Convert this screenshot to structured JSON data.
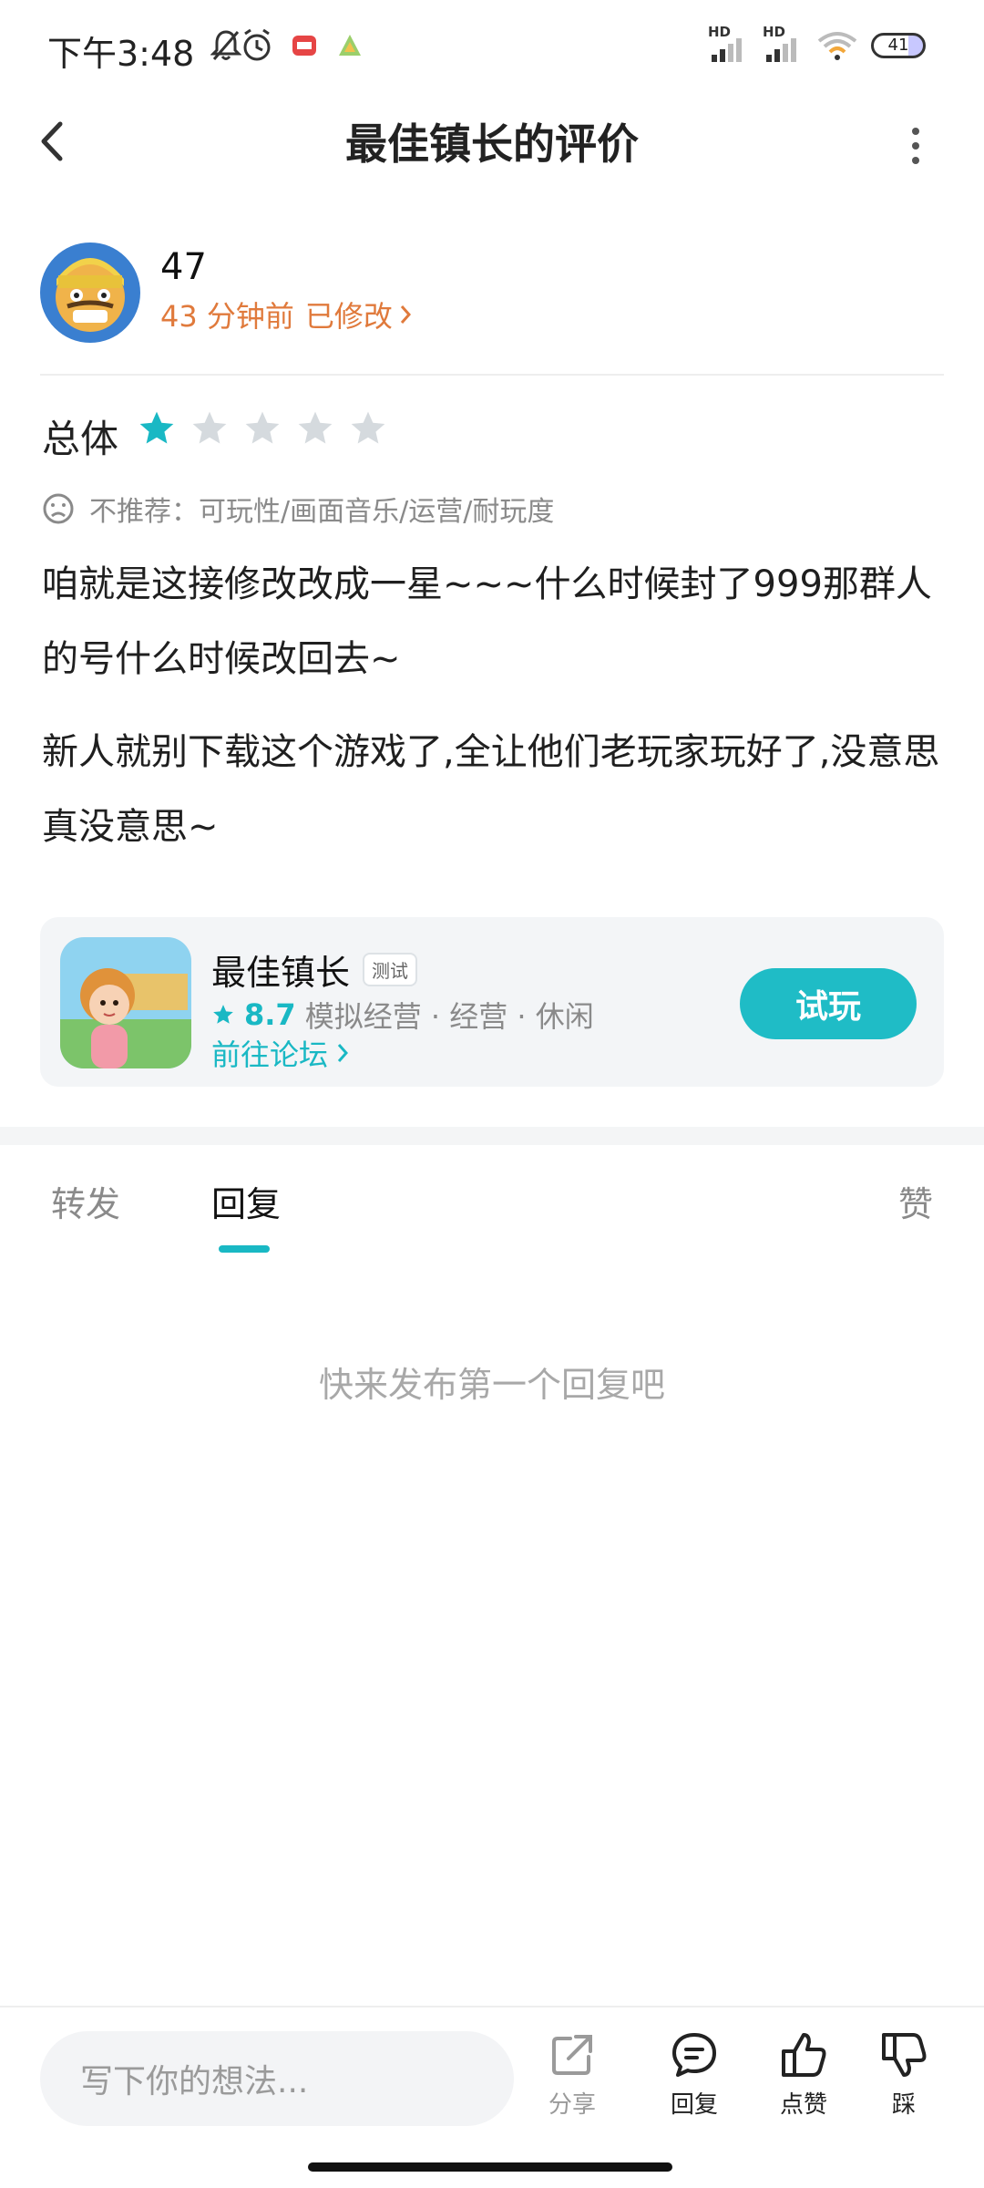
{
  "status_bar": {
    "time": "下午3:48",
    "hd1": "HD",
    "hd2": "HD",
    "battery": "41"
  },
  "header": {
    "title": "最佳镇长的评价"
  },
  "author": {
    "name": "47",
    "time": "43 分钟前",
    "edited_label": "已修改"
  },
  "rating": {
    "label": "总体",
    "value": 1,
    "max": 5,
    "active_color": "#19b8c4",
    "inactive_color": "#d5dade"
  },
  "not_recommended": {
    "text": "不推荐：可玩性/画面音乐/运营/耐玩度"
  },
  "review": {
    "paragraph1": "咱就是这接修改改成一星~~~什么时候封了999那群人的号什么时候改回去~",
    "paragraph2": "新人就别下载这个游戏了,全让他们老玩家玩好了,没意思真没意思~"
  },
  "game_card": {
    "name": "最佳镇长",
    "tag": "测试",
    "score": "8.7",
    "categories": "模拟经营 · 经营 · 休闲",
    "forum_link": "前往论坛",
    "try_label": "试玩"
  },
  "tabs": {
    "repost": "转发",
    "reply": "回复",
    "like": "赞",
    "active": "reply"
  },
  "empty_hint": "快来发布第一个回复吧",
  "bottom_bar": {
    "input_placeholder": "写下你的想法...",
    "share": "分享",
    "reply": "回复",
    "like": "点赞",
    "dislike": "踩"
  },
  "colors": {
    "accent": "#19b8c4",
    "meta_orange": "#e07a3c"
  }
}
